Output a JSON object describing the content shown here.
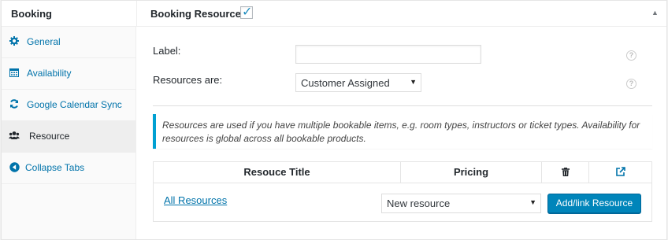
{
  "header": {
    "panel_title": "Booking",
    "resource_label": "Booking Resource:",
    "resource_checked": "✓",
    "toggle": "▲"
  },
  "sidebar": {
    "items": [
      {
        "label": "General",
        "icon": "gear-icon"
      },
      {
        "label": "Availability",
        "icon": "calendar-icon"
      },
      {
        "label": "Google Calendar Sync",
        "icon": "sync-icon"
      },
      {
        "label": "Resource",
        "icon": "users-icon"
      },
      {
        "label": "Collapse Tabs",
        "icon": "collapse-icon"
      }
    ],
    "active": "Resource"
  },
  "form": {
    "label_field": {
      "label": "Label:",
      "value": ""
    },
    "resources_are": {
      "label": "Resources are:",
      "selected": "Customer Assigned"
    },
    "help_glyph": "?"
  },
  "notice": "Resources are used if you have multiple bookable items, e.g. room types, instructors or ticket types. Availability for resources is global across all bookable products.",
  "table": {
    "columns": [
      "Resouce Title",
      "Pricing",
      "trash-icon",
      "external-link-icon"
    ],
    "all_resources_link": "All Resources",
    "new_resource_select": "New resource",
    "add_button": "Add/link Resource"
  },
  "colors": {
    "accent": "#0073aa",
    "button": "#0085ba",
    "notice_border": "#00a0d2"
  }
}
